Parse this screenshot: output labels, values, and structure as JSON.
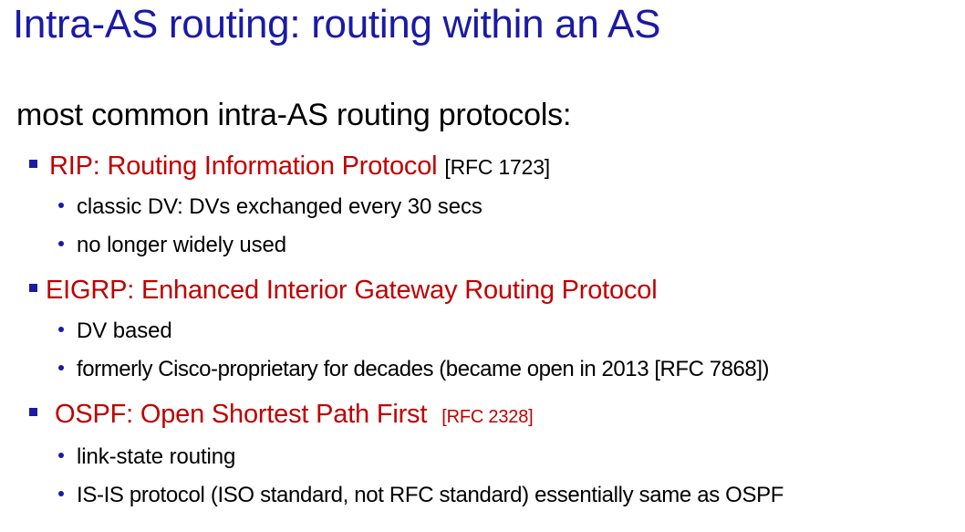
{
  "title": "Intra-AS routing:  routing within an AS",
  "intro": "most common intra-AS routing protocols:",
  "protocols": [
    {
      "name": "RIP: Routing Information Protocol",
      "rfc": "[RFC 1723]",
      "points": [
        "classic DV: DVs exchanged every 30 secs",
        "no longer widely used"
      ]
    },
    {
      "name": "EIGRP: Enhanced Interior Gateway Routing Protocol",
      "rfc": "",
      "points": [
        "DV based",
        "formerly Cisco-proprietary for decades (became open in 2013 [RFC 7868])"
      ]
    },
    {
      "name": "OSPF: Open Shortest Path First",
      "rfc": "[RFC 2328]",
      "points": [
        "link-state routing",
        "IS-IS protocol (ISO standard, not RFC standard) essentially same as OSPF"
      ]
    }
  ],
  "colors": {
    "title": "#1a1aa6",
    "protocol_name": "#c00000",
    "bullets": "#1a1aa6",
    "text": "#000000"
  }
}
